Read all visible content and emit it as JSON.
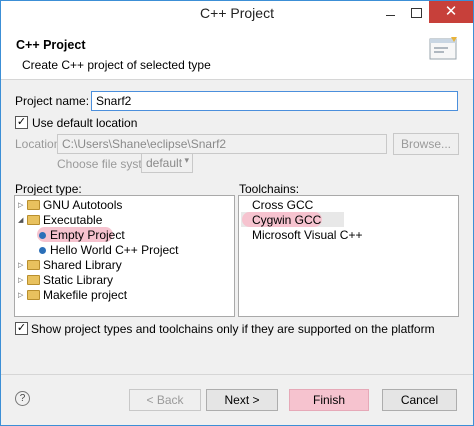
{
  "window": {
    "title": "C++ Project",
    "close_glyph": "✕"
  },
  "header": {
    "title": "C++ Project",
    "description": "Create C++ project of selected type"
  },
  "project_name": {
    "label": "Project name:",
    "value": "Snarf2"
  },
  "use_default_location": {
    "label": "Use default location",
    "checked": true
  },
  "location": {
    "label": "Location:",
    "value": "C:\\Users\\Shane\\eclipse\\Snarf2",
    "browse_label": "Browse..."
  },
  "file_system": {
    "label": "Choose file system:",
    "value": "default"
  },
  "project_type": {
    "label": "Project type:",
    "items": [
      {
        "label": "GNU Autotools"
      },
      {
        "label": "Executable"
      },
      {
        "label": "Empty Project"
      },
      {
        "label": "Hello World C++ Project"
      },
      {
        "label": "Shared Library"
      },
      {
        "label": "Static Library"
      },
      {
        "label": "Makefile project"
      }
    ]
  },
  "toolchains": {
    "label": "Toolchains:",
    "items": [
      {
        "label": "Cross GCC"
      },
      {
        "label": "Cygwin GCC"
      },
      {
        "label": "Microsoft Visual C++"
      }
    ]
  },
  "show_supported": {
    "label": "Show project types and toolchains only if they are supported on the platform",
    "checked": true
  },
  "footer": {
    "help_glyph": "?",
    "back_label": "< Back",
    "next_label": "Next >",
    "finish_label": "Finish",
    "cancel_label": "Cancel"
  },
  "colors": {
    "highlight": "#f6c3cf",
    "title_close": "#c7403a",
    "accent": "#3c8fd6"
  }
}
